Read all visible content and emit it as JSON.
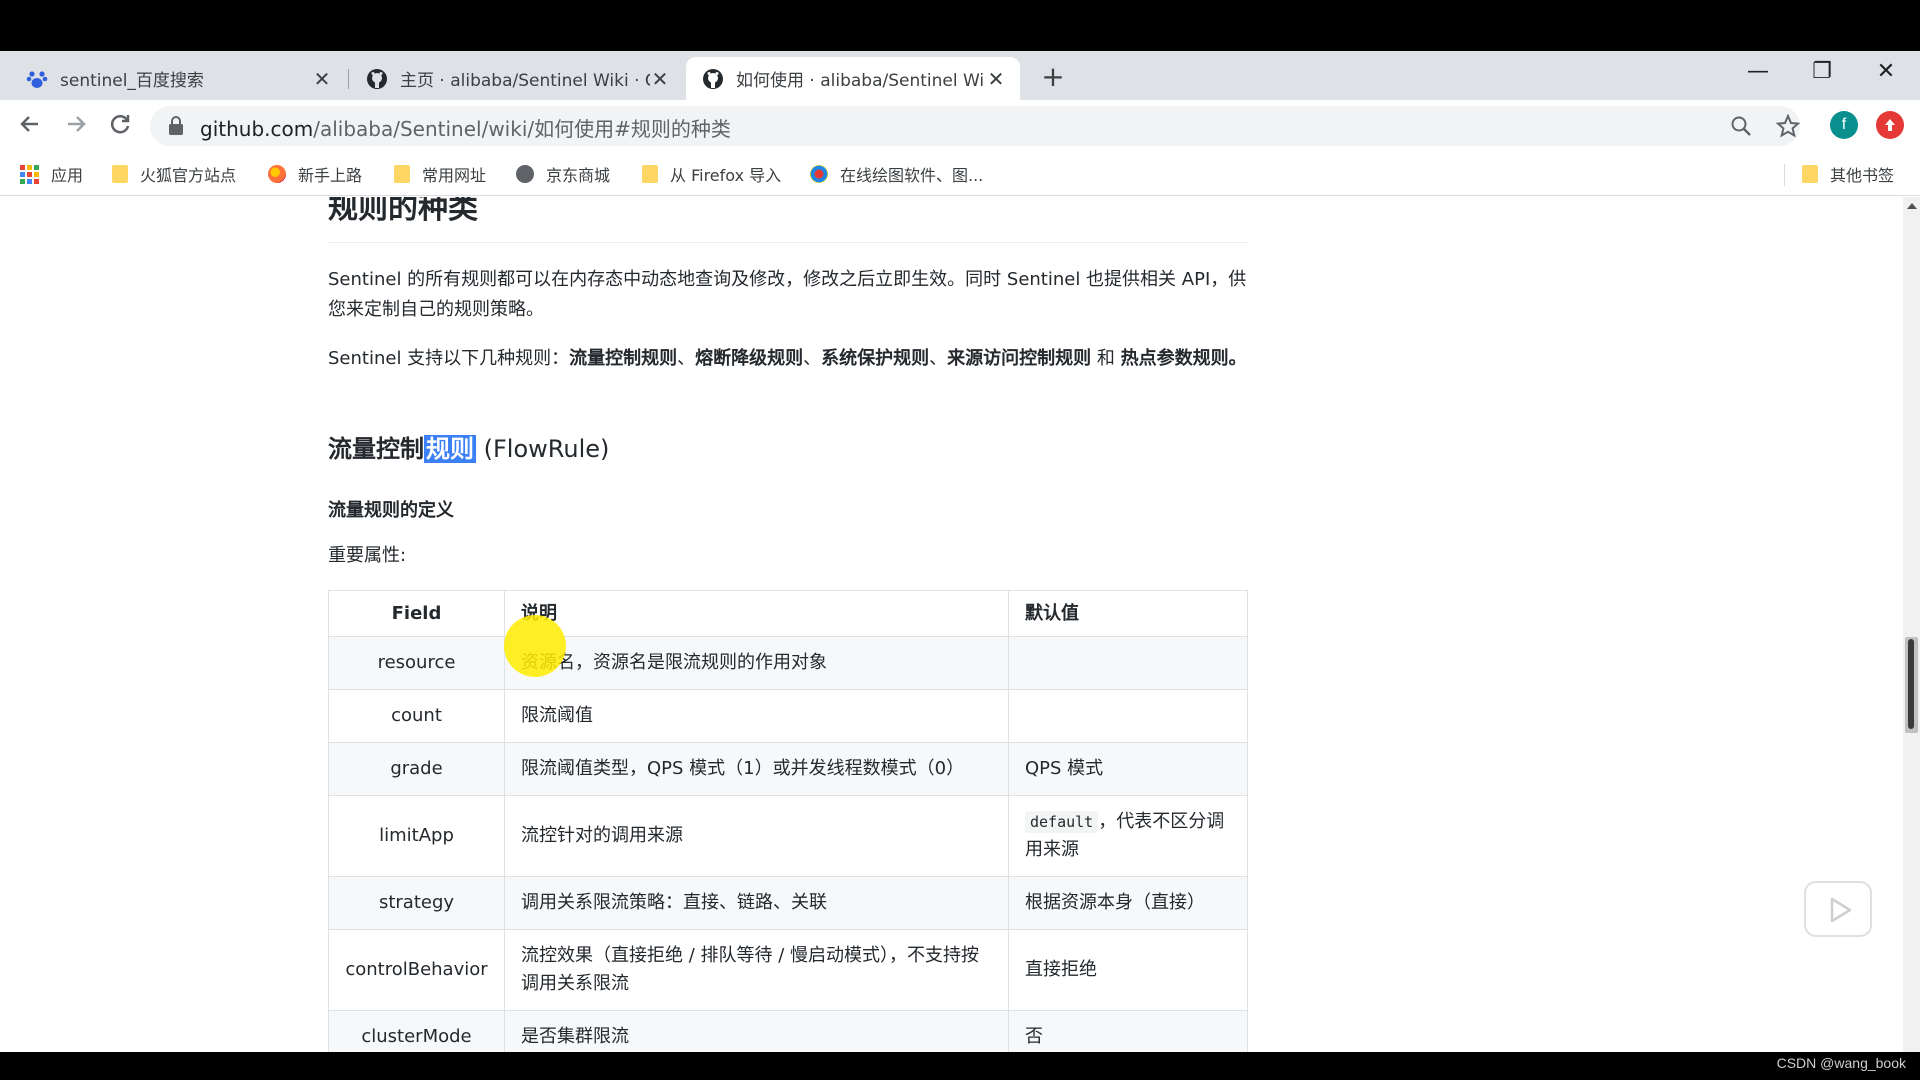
{
  "browser": {
    "tabs": [
      {
        "title": "sentinel_百度搜索",
        "icon": "baidu-paw-icon",
        "close": "✕"
      },
      {
        "title": "主页 · alibaba/Sentinel Wiki · G",
        "icon": "github-icon",
        "close": "✕"
      },
      {
        "title": "如何使用 · alibaba/Sentinel Wi",
        "icon": "github-icon",
        "close": "✕"
      }
    ],
    "new_tab": "+",
    "window_controls": {
      "minimize": "—",
      "restore": "❐",
      "close": "✕"
    },
    "url_host": "github.com",
    "url_path": "/alibaba/Sentinel/wiki/如何使用#规则的种类",
    "profile_letter": "f",
    "bookmarks": [
      {
        "label": "应用",
        "icon": "apps-grid-icon"
      },
      {
        "label": "火狐官方站点",
        "icon": "folder-icon"
      },
      {
        "label": "新手上路",
        "icon": "firefox-icon"
      },
      {
        "label": "常用网址",
        "icon": "folder-icon"
      },
      {
        "label": "京东商城",
        "icon": "globe-icon"
      },
      {
        "label": "从 Firefox 导入",
        "icon": "folder-icon"
      },
      {
        "label": "在线绘图软件、图...",
        "icon": "drawing-site-icon"
      }
    ],
    "other_bookmarks": "其他书签"
  },
  "article": {
    "section_title": "规则的种类",
    "intro": "Sentinel 的所有规则都可以在内存态中动态地查询及修改，修改之后立即生效。同时 Sentinel 也提供相关 API，供您来定制自己的规则策略。",
    "supports_prefix": "Sentinel 支持以下几种规则：",
    "rule_types": [
      "流量控制规则",
      "熔断降级规则",
      "系统保护规则",
      "来源访问控制规则",
      "热点参数规则"
    ],
    "sep": "、",
    "and": " 和 ",
    "end": "。",
    "flow_title_a": "流量控制",
    "flow_title_hl": "规则",
    "flow_title_en": " (FlowRule)",
    "definition_title": "流量规则的定义",
    "important_props": "重要属性:",
    "table": {
      "headers": [
        "Field",
        "说明",
        "默认值"
      ],
      "rows": [
        {
          "field": "resource",
          "desc": "资源名，资源名是限流规则的作用对象",
          "default": ""
        },
        {
          "field": "count",
          "desc": "限流阈值",
          "default": ""
        },
        {
          "field": "grade",
          "desc": "限流阈值类型，QPS 模式（1）或并发线程数模式（0）",
          "default": "QPS 模式"
        },
        {
          "field": "limitApp",
          "desc": "流控针对的调用来源",
          "default_code": "default",
          "default": "，代表不区分调用来源"
        },
        {
          "field": "strategy",
          "desc": "调用关系限流策略：直接、链路、关联",
          "default": "根据资源本身（直接）"
        },
        {
          "field": "controlBehavior",
          "desc": "流控效果（直接拒绝 / 排队等待 / 慢启动模式），不支持按调用关系限流",
          "default": "直接拒绝"
        },
        {
          "field": "clusterMode",
          "desc": "是否集群限流",
          "default": "否"
        }
      ]
    }
  },
  "watermark": "CSDN @wang_book",
  "colors": {
    "highlight": "#3b80f6",
    "cursor_marker": "#ffec00",
    "profile": "#0a8f8f",
    "extension": "#e53935"
  }
}
